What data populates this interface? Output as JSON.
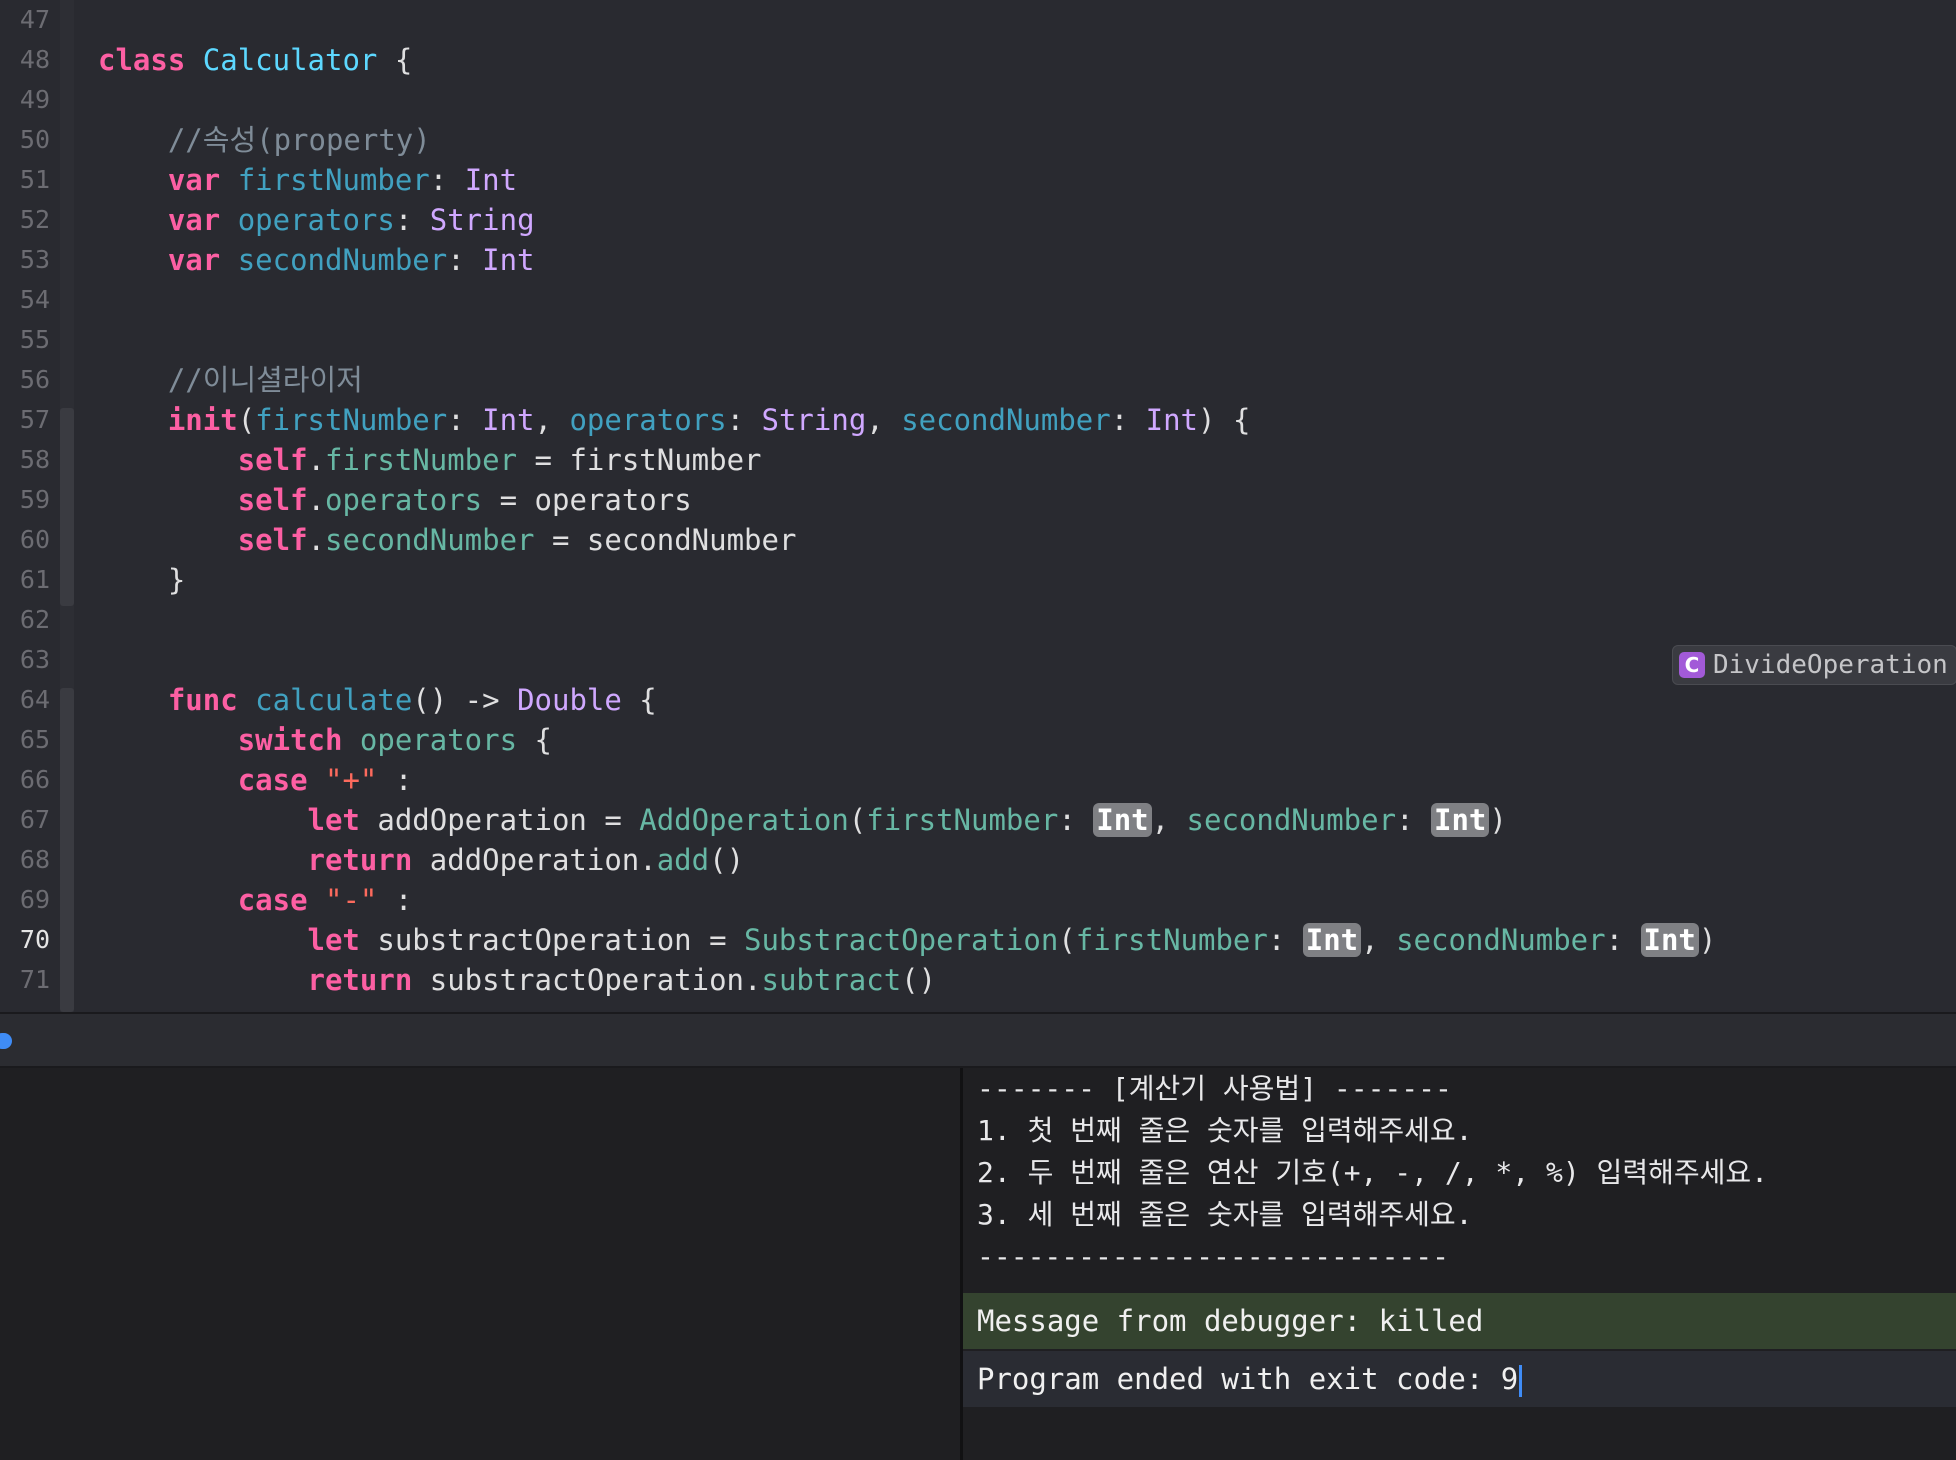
{
  "editor": {
    "lines": [
      {
        "n": "47",
        "tokens": []
      },
      {
        "n": "48",
        "tokens": [
          [
            "kw",
            "class"
          ],
          [
            "p",
            " "
          ],
          [
            "cls",
            "Calculator"
          ],
          [
            "p",
            " {"
          ]
        ]
      },
      {
        "n": "49",
        "tokens": []
      },
      {
        "n": "50",
        "tokens": [
          [
            "p",
            "    "
          ],
          [
            "cm",
            "//속성(property)"
          ]
        ]
      },
      {
        "n": "51",
        "tokens": [
          [
            "p",
            "    "
          ],
          [
            "kw",
            "var"
          ],
          [
            "p",
            " "
          ],
          [
            "decl",
            "firstNumber"
          ],
          [
            "p",
            ": "
          ],
          [
            "ty",
            "Int"
          ]
        ]
      },
      {
        "n": "52",
        "tokens": [
          [
            "p",
            "    "
          ],
          [
            "kw",
            "var"
          ],
          [
            "p",
            " "
          ],
          [
            "decl",
            "operators"
          ],
          [
            "p",
            ": "
          ],
          [
            "ty",
            "String"
          ]
        ]
      },
      {
        "n": "53",
        "tokens": [
          [
            "p",
            "    "
          ],
          [
            "kw",
            "var"
          ],
          [
            "p",
            " "
          ],
          [
            "decl",
            "secondNumber"
          ],
          [
            "p",
            ": "
          ],
          [
            "ty",
            "Int"
          ]
        ]
      },
      {
        "n": "54",
        "tokens": []
      },
      {
        "n": "55",
        "tokens": []
      },
      {
        "n": "56",
        "tokens": [
          [
            "p",
            "    "
          ],
          [
            "cm",
            "//이니셜라이저"
          ]
        ]
      },
      {
        "n": "57",
        "tokens": [
          [
            "p",
            "    "
          ],
          [
            "kw",
            "init"
          ],
          [
            "p",
            "("
          ],
          [
            "decl",
            "firstNumber"
          ],
          [
            "p",
            ": "
          ],
          [
            "ty",
            "Int"
          ],
          [
            "p",
            ", "
          ],
          [
            "decl",
            "operators"
          ],
          [
            "p",
            ": "
          ],
          [
            "ty",
            "String"
          ],
          [
            "p",
            ", "
          ],
          [
            "decl",
            "secondNumber"
          ],
          [
            "p",
            ": "
          ],
          [
            "ty",
            "Int"
          ],
          [
            "p",
            ") {"
          ]
        ]
      },
      {
        "n": "58",
        "tokens": [
          [
            "p",
            "        "
          ],
          [
            "kw",
            "self"
          ],
          [
            "p",
            "."
          ],
          [
            "prop",
            "firstNumber"
          ],
          [
            "p",
            " = firstNumber"
          ]
        ]
      },
      {
        "n": "59",
        "tokens": [
          [
            "p",
            "        "
          ],
          [
            "kw",
            "self"
          ],
          [
            "p",
            "."
          ],
          [
            "prop",
            "operators"
          ],
          [
            "p",
            " = operators"
          ]
        ]
      },
      {
        "n": "60",
        "tokens": [
          [
            "p",
            "        "
          ],
          [
            "kw",
            "self"
          ],
          [
            "p",
            "."
          ],
          [
            "prop",
            "secondNumber"
          ],
          [
            "p",
            " = secondNumber"
          ]
        ]
      },
      {
        "n": "61",
        "tokens": [
          [
            "p",
            "    }"
          ]
        ]
      },
      {
        "n": "62",
        "tokens": []
      },
      {
        "n": "63",
        "tokens": []
      },
      {
        "n": "64",
        "tokens": [
          [
            "p",
            "    "
          ],
          [
            "kw",
            "func"
          ],
          [
            "p",
            " "
          ],
          [
            "decl",
            "calculate"
          ],
          [
            "p",
            "() -> "
          ],
          [
            "ty",
            "Double"
          ],
          [
            "p",
            " {"
          ]
        ]
      },
      {
        "n": "65",
        "tokens": [
          [
            "p",
            "        "
          ],
          [
            "kw",
            "switch"
          ],
          [
            "p",
            " "
          ],
          [
            "prop",
            "operators"
          ],
          [
            "p",
            " {"
          ]
        ]
      },
      {
        "n": "66",
        "tokens": [
          [
            "p",
            "        "
          ],
          [
            "kw",
            "case"
          ],
          [
            "p",
            " "
          ],
          [
            "str",
            "\"+\""
          ],
          [
            "p",
            " :"
          ]
        ]
      },
      {
        "n": "67",
        "tokens": [
          [
            "p",
            "            "
          ],
          [
            "kw",
            "let"
          ],
          [
            "p",
            " addOperation = "
          ],
          [
            "fn",
            "AddOperation"
          ],
          [
            "p",
            "("
          ],
          [
            "prop",
            "firstNumber"
          ],
          [
            "p",
            ": "
          ],
          [
            "ph",
            "Int"
          ],
          [
            "p",
            ", "
          ],
          [
            "prop",
            "secondNumber"
          ],
          [
            "p",
            ": "
          ],
          [
            "ph",
            "Int"
          ],
          [
            "p",
            ")"
          ]
        ]
      },
      {
        "n": "68",
        "tokens": [
          [
            "p",
            "            "
          ],
          [
            "kw",
            "return"
          ],
          [
            "p",
            " addOperation."
          ],
          [
            "prop",
            "add"
          ],
          [
            "p",
            "()"
          ]
        ]
      },
      {
        "n": "69",
        "tokens": [
          [
            "p",
            "        "
          ],
          [
            "kw",
            "case"
          ],
          [
            "p",
            " "
          ],
          [
            "str",
            "\"-\""
          ],
          [
            "p",
            " :"
          ]
        ]
      },
      {
        "n": "70",
        "tokens": [
          [
            "p",
            "            "
          ],
          [
            "kw",
            "let"
          ],
          [
            "p",
            " substractOperation = "
          ],
          [
            "fn",
            "SubstractOperation"
          ],
          [
            "p",
            "("
          ],
          [
            "prop",
            "firstNumber"
          ],
          [
            "p",
            ": "
          ],
          [
            "ph",
            "Int"
          ],
          [
            "p",
            ", "
          ],
          [
            "prop",
            "secondNumber"
          ],
          [
            "p",
            ": "
          ],
          [
            "ph",
            "Int"
          ],
          [
            "p",
            ")"
          ]
        ],
        "current": true
      },
      {
        "n": "71",
        "tokens": [
          [
            "p",
            "            "
          ],
          [
            "kw",
            "return"
          ],
          [
            "p",
            " substractOperation."
          ],
          [
            "prop",
            "subtract"
          ],
          [
            "p",
            "()"
          ]
        ]
      }
    ],
    "class_badge": {
      "icon_letter": "C",
      "label": "DivideOperation"
    }
  },
  "console": {
    "lines": [
      "------- [계산기 사용법] -------",
      "1. 첫 번째 줄은 숫자를 입력해주세요.",
      "2. 두 번째 줄은 연산 기호(+, -, /, *, %) 입력해주세요.",
      "3. 세 번째 줄은 숫자를 입력해주세요.",
      "----------------------------"
    ],
    "debugger_message": "Message from debugger: killed",
    "exit_message": "Program ended with exit code: 9"
  },
  "colors": {
    "editor_bg": "#292a30",
    "keyword": "#fc5fa3",
    "type": "#d0a8ff",
    "comment": "#7f8c98",
    "debugger_bar": "#34432f",
    "accent": "#3f8cf6"
  }
}
